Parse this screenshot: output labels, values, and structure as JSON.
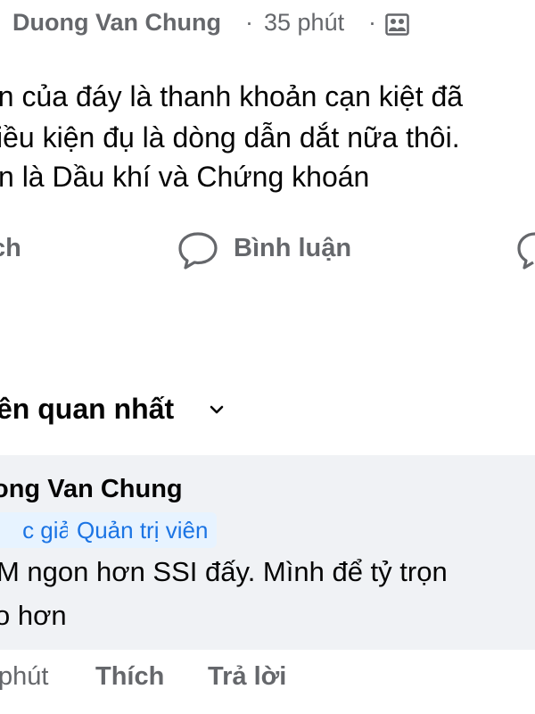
{
  "post_header": {
    "author": "Duong Van Chung",
    "separator_1": "·",
    "time": "35 phút",
    "separator_2": "·",
    "privacy_icon": "group-members-icon"
  },
  "post_body": {
    "lines": [
      "ần của đáy là thanh khoản cạn kiệt đã",
      "iều kiện đụ là dòng dẫn dắt nữa thôi.",
      "n là Dầu khí và Chứng khoán"
    ]
  },
  "actions": {
    "like_label": "ch",
    "comment_label": "Bình luận",
    "comment_icon": "comment-bubble-icon",
    "share_icon": "share-icon"
  },
  "comments_section": {
    "sort_label": "ên quan nhất",
    "sort_icon": "chevron-down-icon"
  },
  "comment": {
    "author": "ong Van Chung",
    "badges": [
      "c giả",
      "Quản trị viên"
    ],
    "text_lines": [
      "M ngon hơn SSI đấy. Mình để tỷ trọn",
      "o hơn"
    ],
    "time": "phút",
    "like_label": "Thích",
    "reply_label": "Trả lời"
  },
  "colors": {
    "secondary_text": "#65676b",
    "primary_text": "#050505",
    "bubble_bg": "#f0f2f5",
    "badge_bg": "#e7f3ff",
    "badge_text": "#1b74e4"
  }
}
